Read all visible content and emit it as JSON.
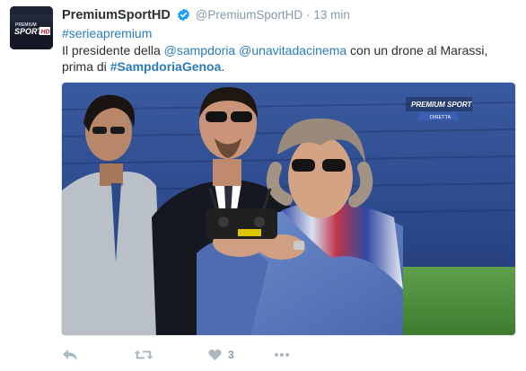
{
  "tweet": {
    "display_name": "PremiumSportHD",
    "handle": "@PremiumSportHD",
    "separator": "·",
    "time": "13 min",
    "hashtag_line": "#serieapremium",
    "text_part1": "Il presidente della ",
    "mention1": "@sampdoria",
    "text_space": " ",
    "mention2": "@unavitadacinema",
    "text_part2": " con un drone al Marassi,",
    "text_part3": "prima di ",
    "hashtag2": "#SampdoriaGenoa",
    "text_end": "."
  },
  "avatar": {
    "line1": "PREMIUM",
    "line2": "SPORT",
    "badge": "HD"
  },
  "media": {
    "watermark_line1": "PREMIUM SPORT",
    "watermark_line2": "DIRETTA"
  },
  "actions": {
    "like_count": "3"
  },
  "colors": {
    "link": "#2b7bb9",
    "muted": "#8899a6",
    "text": "#292f33",
    "verified": "#1da1f2"
  }
}
